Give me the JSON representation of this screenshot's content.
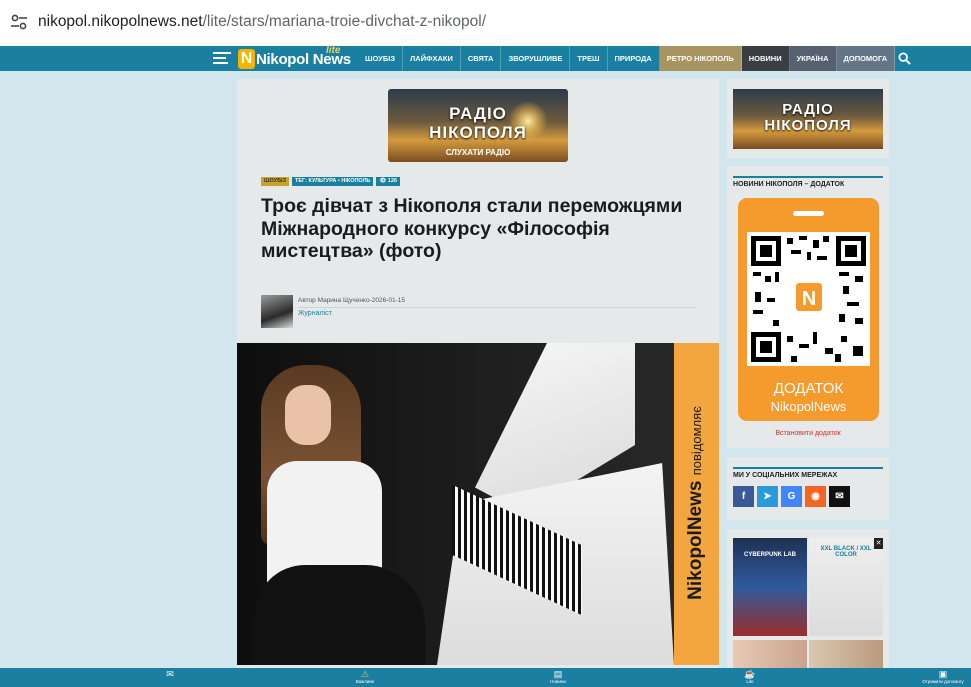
{
  "browser": {
    "url_host": "nikopol.nikopolnews.net",
    "url_path": "/lite/stars/mariana-troie-divchat-z-nikopol/"
  },
  "site": {
    "logo_text": "Nikopol News",
    "logo_letter": "N",
    "logo_badge": "lite",
    "nav": [
      "ШОУБІЗ",
      "ЛАЙФХАКИ",
      "СВЯТА",
      "ЗВОРУШЛИВЕ",
      "ТРЕШ",
      "ПРИРОДА",
      "РЕТРО НІКОПОЛЬ",
      "НОВИНИ",
      "УКРАЇНА",
      "ДОПОМОГА"
    ]
  },
  "banner": {
    "line1": "РАДІО",
    "line2": "НІКОПОЛЯ",
    "cta": "СЛУХАТИ РАДІО"
  },
  "article": {
    "category": "ШОУБІЗ",
    "tags": "ТЕГ: КУЛЬТУРА • НІКОПОЛЬ",
    "views": "126",
    "title": "Троє дівчат з Нікополя стали переможцями Міжнародного конкурсу «Філософія мистецтва» (фото)",
    "author_meta": "Автор Марина Щученко-2026-01-15",
    "author_role": "Журналіст",
    "photo_brand": "NikopolNews",
    "photo_brand_suffix": "повідомляє"
  },
  "sidebar": {
    "radio_line1": "РАДІО",
    "radio_line2": "НІКОПОЛЯ",
    "app_title": "НОВИНИ НІКОПОЛЯ – ДОДАТОК",
    "app_label1": "ДОДАТОК",
    "app_label2": "NikopolNews",
    "install": "Встановити додаток",
    "social_title": "МИ У СОЦІАЛЬНИХ МЕРЕЖАХ",
    "social": [
      {
        "icon": "facebook-icon",
        "glyph": "f",
        "color": "#3b5998"
      },
      {
        "icon": "telegram-icon",
        "glyph": "➤",
        "color": "#2a9bd8"
      },
      {
        "icon": "google-icon",
        "glyph": "G",
        "color": "#4285f4"
      },
      {
        "icon": "rss-icon",
        "glyph": "◉",
        "color": "#f26522"
      },
      {
        "icon": "email-icon",
        "glyph": "✉",
        "color": "#111111"
      }
    ],
    "ad1_label": "CYBERPUNK LAB",
    "ad2_label": "XXL BLACK / XXL COLOR"
  },
  "bottom": {
    "items": [
      {
        "icon": "mail-icon",
        "glyph": "✉",
        "label": ""
      },
      {
        "icon": "warning-icon",
        "glyph": "⚠",
        "label": "Важливе"
      },
      {
        "icon": "news-icon",
        "glyph": "▤",
        "label": "Новини"
      },
      {
        "icon": "lite-icon",
        "glyph": "☕",
        "label": "Lite"
      },
      {
        "icon": "camera-icon",
        "glyph": "▣",
        "label": "Отримати допомогу"
      }
    ]
  },
  "colors": {
    "primary": "#1a7fa0",
    "accent_orange": "#f59a2c",
    "retro": "#a89461",
    "news": "#3b3f44"
  }
}
